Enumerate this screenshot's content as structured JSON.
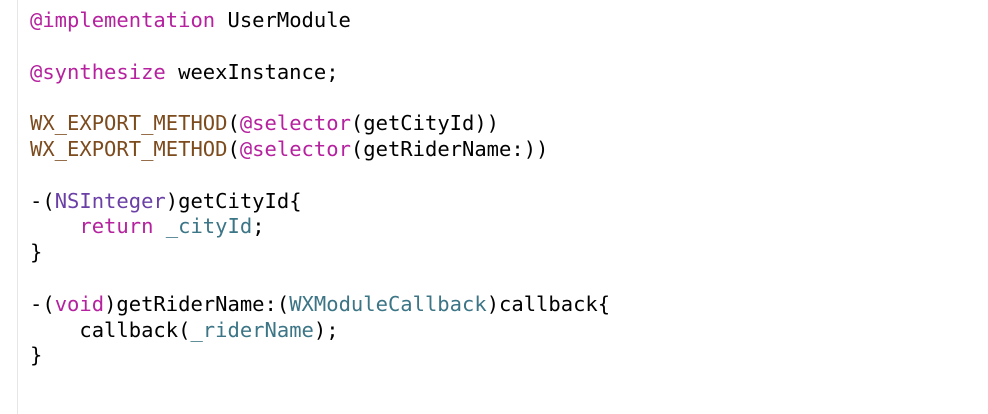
{
  "editor": {
    "language": "Objective-C",
    "colors": {
      "plain": "#000000",
      "keyword": "#b5219e",
      "macro": "#7c4b1e",
      "type": "#6a3fa6",
      "ident": "#3c7586",
      "background": "#ffffff",
      "gutter_rule": "#e6e6e6"
    },
    "lines": [
      [
        {
          "t": "@implementation",
          "k": "keyword"
        },
        {
          "t": " UserModule",
          "k": "plain"
        }
      ],
      [],
      [
        {
          "t": "@synthesize",
          "k": "keyword"
        },
        {
          "t": " weexInstance;",
          "k": "plain"
        }
      ],
      [],
      [
        {
          "t": "WX_EXPORT_METHOD",
          "k": "macro"
        },
        {
          "t": "(",
          "k": "plain"
        },
        {
          "t": "@selector",
          "k": "keyword"
        },
        {
          "t": "(getCityId))",
          "k": "plain"
        }
      ],
      [
        {
          "t": "WX_EXPORT_METHOD",
          "k": "macro"
        },
        {
          "t": "(",
          "k": "plain"
        },
        {
          "t": "@selector",
          "k": "keyword"
        },
        {
          "t": "(getRiderName:))",
          "k": "plain"
        }
      ],
      [],
      [
        {
          "t": "-(",
          "k": "plain"
        },
        {
          "t": "NSInteger",
          "k": "type"
        },
        {
          "t": ")getCityId{",
          "k": "plain"
        }
      ],
      [
        {
          "t": "    ",
          "k": "plain"
        },
        {
          "t": "return",
          "k": "keyword"
        },
        {
          "t": " ",
          "k": "plain"
        },
        {
          "t": "_cityId",
          "k": "ident"
        },
        {
          "t": ";",
          "k": "plain"
        }
      ],
      [
        {
          "t": "}",
          "k": "plain"
        }
      ],
      [],
      [
        {
          "t": "-(",
          "k": "plain"
        },
        {
          "t": "void",
          "k": "keyword"
        },
        {
          "t": ")getRiderName:(",
          "k": "plain"
        },
        {
          "t": "WXModuleCallback",
          "k": "ident"
        },
        {
          "t": ")callback{",
          "k": "plain"
        }
      ],
      [
        {
          "t": "    callback(",
          "k": "plain"
        },
        {
          "t": "_riderName",
          "k": "ident"
        },
        {
          "t": ");",
          "k": "plain"
        }
      ],
      [
        {
          "t": "}",
          "k": "plain"
        }
      ]
    ]
  }
}
